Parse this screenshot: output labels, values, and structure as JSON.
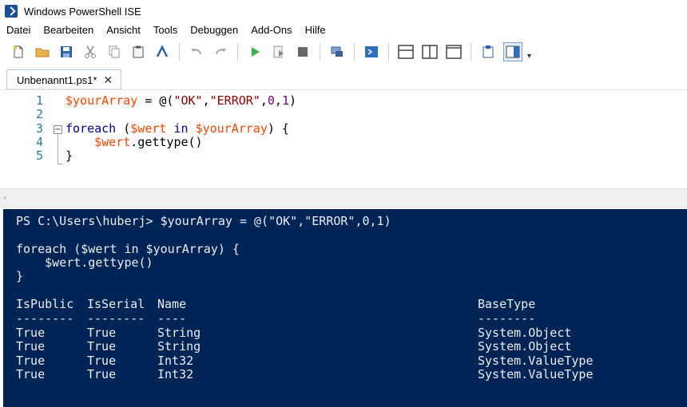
{
  "window": {
    "title": "Windows PowerShell ISE"
  },
  "menu": [
    "Datei",
    "Bearbeiten",
    "Ansicht",
    "Tools",
    "Debuggen",
    "Add-Ons",
    "Hilfe"
  ],
  "tab": {
    "label": "Unbenannt1.ps1*",
    "close": "✕"
  },
  "editor": {
    "line_numbers": [
      "1",
      "2",
      "3",
      "4",
      "5"
    ],
    "lines": [
      [
        {
          "t": "var",
          "v": "$yourArray"
        },
        {
          "t": "txt",
          "v": " = @("
        },
        {
          "t": "str",
          "v": "\"OK\""
        },
        {
          "t": "txt",
          "v": ","
        },
        {
          "t": "str",
          "v": "\"ERROR\""
        },
        {
          "t": "txt",
          "v": ","
        },
        {
          "t": "num",
          "v": "0"
        },
        {
          "t": "txt",
          "v": ","
        },
        {
          "t": "num",
          "v": "1"
        },
        {
          "t": "txt",
          "v": ")"
        }
      ],
      [],
      [
        {
          "t": "kw",
          "v": "foreach"
        },
        {
          "t": "txt",
          "v": " ("
        },
        {
          "t": "var",
          "v": "$wert"
        },
        {
          "t": "txt",
          "v": " "
        },
        {
          "t": "kw",
          "v": "in"
        },
        {
          "t": "txt",
          "v": " "
        },
        {
          "t": "var",
          "v": "$yourArray"
        },
        {
          "t": "txt",
          "v": ") {"
        }
      ],
      [
        {
          "t": "txt",
          "v": "    "
        },
        {
          "t": "var",
          "v": "$wert"
        },
        {
          "t": "txt",
          "v": ".gettype()"
        }
      ],
      [
        {
          "t": "txt",
          "v": "}"
        }
      ]
    ]
  },
  "console": {
    "lines": [
      "PS C:\\Users\\huberj> $yourArray = @(\"OK\",\"ERROR\",0,1)",
      "",
      "foreach ($wert in $yourArray) {",
      "    $wert.gettype()",
      "}"
    ],
    "table": {
      "headers": [
        "IsPublic",
        "IsSerial",
        "Name",
        "BaseType"
      ],
      "dashes": [
        "--------",
        "--------",
        "----",
        "--------"
      ],
      "rows": [
        [
          "True",
          "True",
          "String",
          "System.Object"
        ],
        [
          "True",
          "True",
          "String",
          "System.Object"
        ],
        [
          "True",
          "True",
          "Int32",
          "System.ValueType"
        ],
        [
          "True",
          "True",
          "Int32",
          "System.ValueType"
        ]
      ]
    }
  },
  "colors": {
    "console_bg": "#012456",
    "console_fg": "#eeedf0",
    "variable": "#ff4500",
    "string": "#8b0000",
    "keyword": "#00008b",
    "number": "#800080"
  }
}
